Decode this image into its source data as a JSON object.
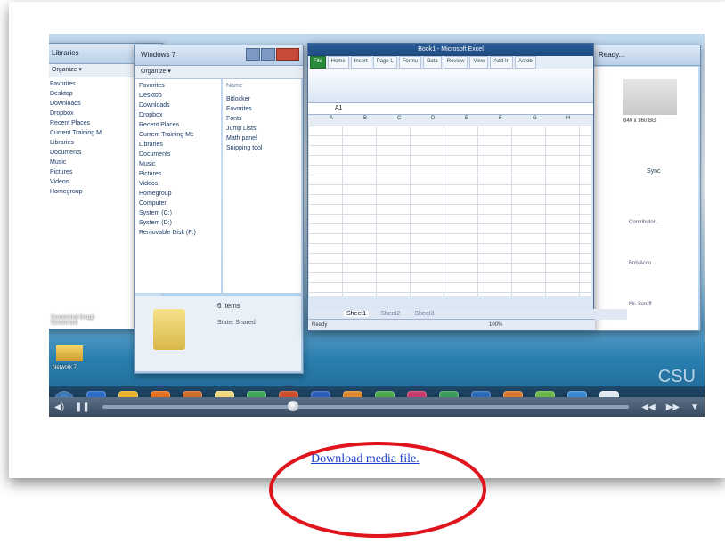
{
  "screen": {
    "left_explorer": {
      "address": "Libraries",
      "toolbar": "Organize ▾",
      "nav": [
        "Favorites",
        "Desktop",
        "Downloads",
        "Dropbox",
        "Recent Places",
        "Current Training M",
        "Libraries",
        "Documents",
        "Music",
        "Pictures",
        "Videos",
        "Homegroup"
      ],
      "status": "Screenshot Snagit Screencast"
    },
    "explorer": {
      "address": "Windows 7",
      "toolbar": "Organize ▾",
      "nav": [
        "Favorites",
        "Desktop",
        "Downloads",
        "Dropbox",
        "Recent Places",
        "Current Training Mc",
        "Libraries",
        "Documents",
        "Music",
        "Pictures",
        "Videos",
        "Homegroup",
        "Computer",
        "System (C:)",
        "System (D:)",
        "Removable Disk (F:)"
      ],
      "name_header": "Name",
      "files": [
        "Bitlocker",
        "Favorites",
        "Fonts",
        "Jump Lists",
        "Math panel",
        "Snipping tool"
      ],
      "items_count": "6 items",
      "state_label": "State:",
      "state_value": "Shared"
    },
    "excel": {
      "title": "Book1 - Microsoft Excel",
      "tabs": [
        "File",
        "Home",
        "Insert",
        "Page L",
        "Formu",
        "Data",
        "Review",
        "View",
        "Add-In",
        "Acrob"
      ],
      "cell_ref": "A1",
      "columns": [
        "A",
        "B",
        "C",
        "D",
        "E",
        "F",
        "G",
        "H"
      ],
      "rows": [
        "1",
        "2",
        "3",
        "4",
        "5",
        "6",
        "7",
        "8",
        "9",
        "10",
        "11",
        "12",
        "13",
        "14",
        "15",
        "16"
      ],
      "sheets": [
        "Sheet1",
        "Sheet2",
        "Sheet3"
      ],
      "status": "Ready",
      "zoom": "100%"
    },
    "right_window": {
      "address": "Ready...",
      "size_label": "640 x 360 BG",
      "sync": "Sync",
      "names": [
        "Contributor...",
        "Bob Acco",
        "Mr. Scruff"
      ]
    },
    "desktop_icon": "Network 7",
    "logo": "CSU"
  },
  "link": {
    "label": "Download media file."
  },
  "colors": {
    "link": "#1a3fd0",
    "annotation": "#e0141c"
  }
}
